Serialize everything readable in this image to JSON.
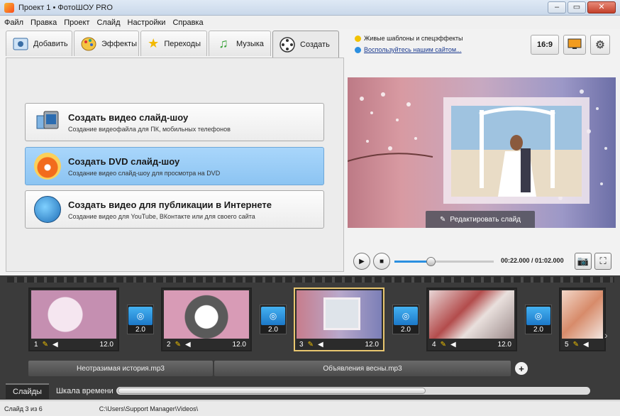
{
  "window": {
    "title": "Проект 1 • ФотоШОУ PRO"
  },
  "menu": [
    "Файл",
    "Правка",
    "Проект",
    "Слайд",
    "Настройки",
    "Справка"
  ],
  "tabs": [
    {
      "label": "Добавить",
      "icon": "add-photo-icon"
    },
    {
      "label": "Эффекты",
      "icon": "effects-palette-icon"
    },
    {
      "label": "Переходы",
      "icon": "star-icon"
    },
    {
      "label": "Музыка",
      "icon": "music-note-icon"
    },
    {
      "label": "Создать",
      "icon": "film-reel-icon",
      "active": true
    }
  ],
  "actions": [
    {
      "title": "Создать видео слайд-шоу",
      "desc": "Создание видеофайла для ПК, мобильных телефонов"
    },
    {
      "title": "Создать DVD слайд-шоу",
      "desc": "Создание видео слайд-шоу для просмотра на DVD",
      "selected": true
    },
    {
      "title": "Создать видео для публикации в Интернете",
      "desc": "Создание видео для YouTube, ВКонтакте или для своего сайта"
    }
  ],
  "right_top": {
    "link1": "Живые шаблоны и спецэффекты",
    "link2": "Воспользуйтесь нашим сайтом...",
    "aspect_label": "16:9"
  },
  "preview": {
    "edit_button_label": "Редактировать слайд"
  },
  "player": {
    "time": "00:22.000 / 01:02.000",
    "progress": 0.36
  },
  "slides": [
    {
      "number": "1",
      "duration": "12.0"
    },
    {
      "number": "2",
      "duration": "12.0"
    },
    {
      "number": "3",
      "duration": "12.0",
      "selected": true
    },
    {
      "number": "4",
      "duration": "12.0"
    },
    {
      "number": "5",
      "duration": "12.0"
    }
  ],
  "transitions": [
    "2.0",
    "2.0",
    "2.0",
    "2.0"
  ],
  "music": [
    "Неотразимая история.mp3",
    "Объявления весны.mp3"
  ],
  "bottom_tabs": [
    "Слайды",
    "Шкала времени"
  ],
  "status": {
    "slide": "Слайд 3 из 6",
    "path": "C:\\Users\\Support Manager\\Videos\\"
  },
  "colors": {
    "selection_blue": "#8cc4f2",
    "accent_gold": "#e8c66f",
    "timeline_bg": "#3b3b3b"
  }
}
